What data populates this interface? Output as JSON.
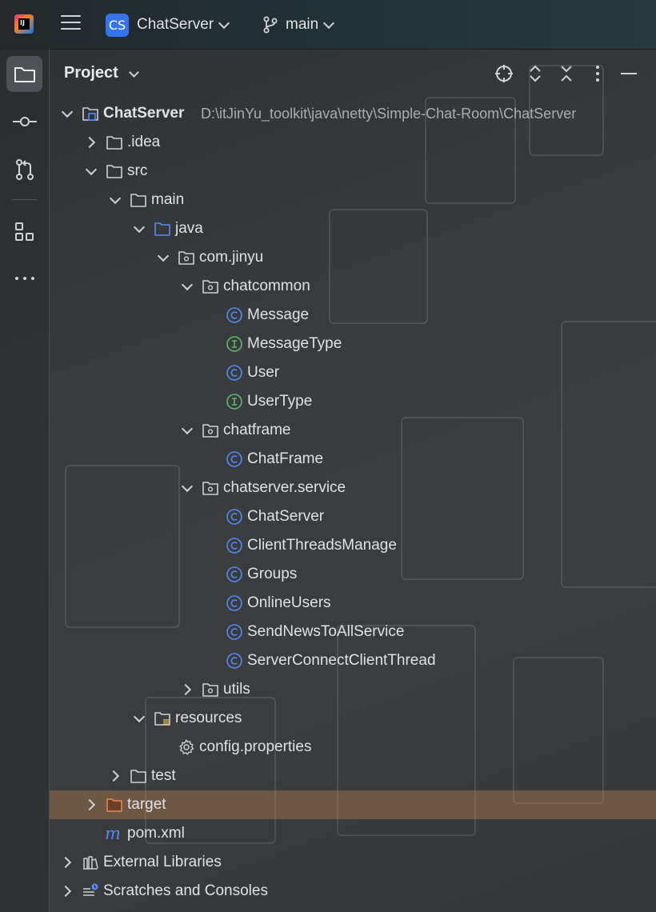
{
  "topbar": {
    "project_badge": "CS",
    "project_name": "ChatServer",
    "branch": "main"
  },
  "stripe": {
    "tools": [
      "project-tool",
      "commit-tool",
      "pull-requests-tool",
      "structure-tool",
      "more-tools"
    ]
  },
  "panel": {
    "title": "Project"
  },
  "tree": {
    "root_label": "ChatServer",
    "root_path": "D:\\itJinYu_toolkit\\java\\netty\\Simple-Chat-Room\\ChatServer",
    "idea": ".idea",
    "src": "src",
    "main": "main",
    "java": "java",
    "package": "com.jinyu",
    "chatcommon": "chatcommon",
    "message": "Message",
    "message_type": "MessageType",
    "user": "User",
    "user_type": "UserType",
    "chatframe": "chatframe",
    "chat_frame": "ChatFrame",
    "chatserver_service": "chatserver.service",
    "chat_server": "ChatServer",
    "client_threads_manage": "ClientThreadsManage",
    "groups": "Groups",
    "online_users": "OnlineUsers",
    "send_news": "SendNewsToAllService",
    "server_connect": "ServerConnectClientThread",
    "utils": "utils",
    "resources": "resources",
    "config": "config.properties",
    "test": "test",
    "target": "target",
    "pom": "pom.xml",
    "external_libraries": "External Libraries",
    "scratches": "Scratches and Consoles"
  },
  "icons": {
    "class_color": "#548af7",
    "interface_color": "#5fb865",
    "folder_color": "#ced0d6",
    "source_folder_color": "#548af7",
    "excluded_folder_color": "#e08855",
    "maven_color": "#548af7"
  }
}
